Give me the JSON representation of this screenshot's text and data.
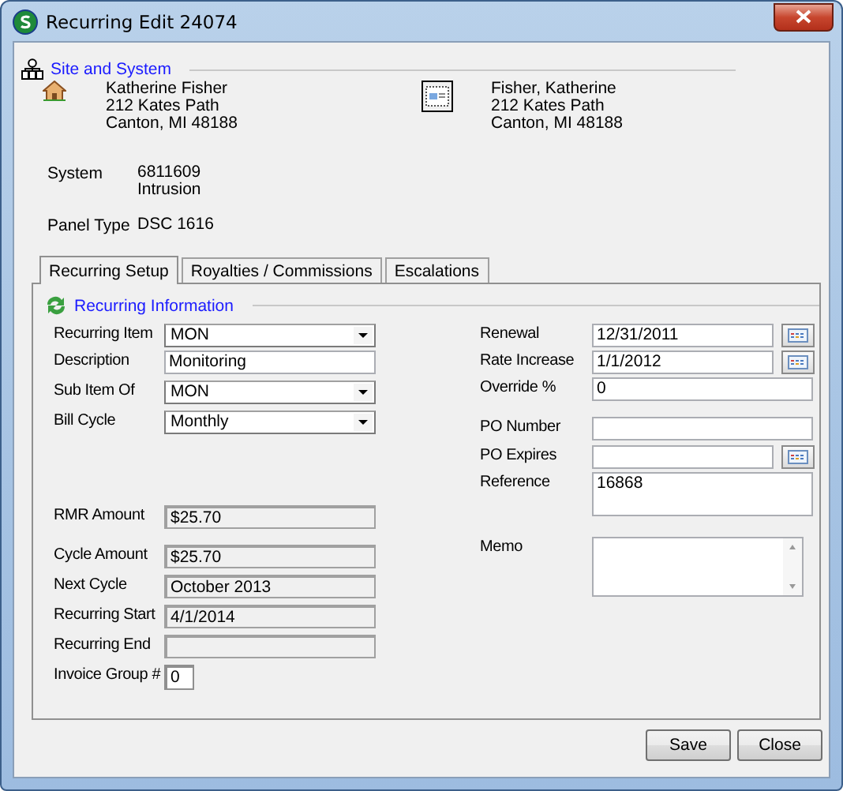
{
  "window": {
    "title": "Recurring Edit 24074"
  },
  "site_section": {
    "title": "Site and System",
    "site_address": [
      "Katherine Fisher",
      "212  Kates Path",
      "Canton, MI  48188"
    ],
    "billing_address": [
      "Fisher, Katherine",
      "212  Kates Path",
      "Canton, MI  48188"
    ],
    "info": [
      {
        "label": "System",
        "lines": [
          "6811609",
          "Intrusion"
        ]
      },
      {
        "label": "Panel Type",
        "lines": [
          "DSC 1616"
        ]
      }
    ]
  },
  "tabs": [
    {
      "label": "Recurring Setup",
      "selected": true
    },
    {
      "label": "Royalties / Commissions",
      "selected": false
    },
    {
      "label": "Escalations",
      "selected": false
    }
  ],
  "recurring_section": {
    "title": "Recurring Information",
    "left_fields": [
      {
        "label": "Recurring Item",
        "kind": "dropdown",
        "value": "MON"
      },
      {
        "label": "Description",
        "kind": "text",
        "value": "Monitoring"
      },
      {
        "label": "Sub Item Of",
        "kind": "dropdown",
        "value": "MON"
      },
      {
        "label": "Bill Cycle",
        "kind": "dropdown",
        "value": "Monthly"
      },
      {
        "label": "RMR Amount",
        "kind": "readonly",
        "value": "$25.70"
      },
      {
        "label": "Cycle Amount",
        "kind": "readonly",
        "value": "$25.70"
      },
      {
        "label": "Next Cycle",
        "kind": "readonly",
        "value": "October 2013"
      },
      {
        "label": "Recurring Start",
        "kind": "readonly",
        "value": "4/1/2014"
      },
      {
        "label": "Recurring End",
        "kind": "readonly"
      },
      {
        "label": "Invoice Group #",
        "kind": "short",
        "value": "0"
      }
    ],
    "right_fields": [
      {
        "label": "Renewal",
        "kind": "date",
        "value": "12/31/2011"
      },
      {
        "label": "Rate Increase",
        "kind": "date",
        "value": "1/1/2012"
      },
      {
        "label": "Override %",
        "kind": "text",
        "value": "0"
      },
      {
        "label": "PO Number",
        "kind": "text"
      },
      {
        "label": "PO Expires",
        "kind": "date"
      },
      {
        "label": "Reference",
        "kind": "multiline",
        "value": "16868"
      },
      {
        "label": "Memo",
        "kind": "memo"
      }
    ]
  },
  "buttons": [
    "Save",
    "Close"
  ]
}
